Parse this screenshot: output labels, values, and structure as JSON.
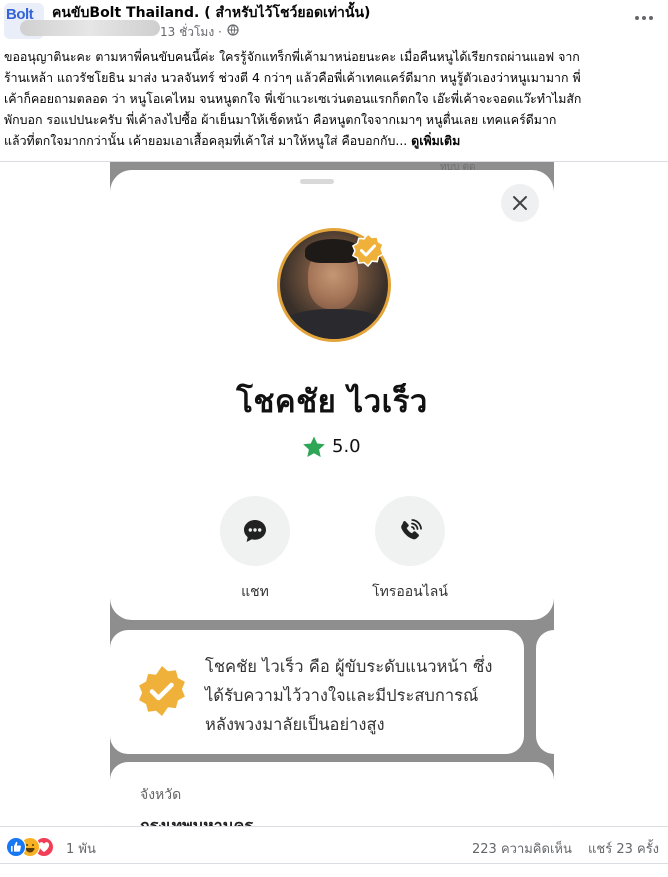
{
  "group": {
    "avatar_text": "Bolt",
    "name": "คนขับBolt Thailand. ( สำหรับไว้โชว์ยอดเท่านั้น)",
    "time": "13 ชั่วโมง ·"
  },
  "post": {
    "lines": [
      "ขออนุญาตินะคะ ตามหาพี่คนขับคนนี้ค่ะ ใครรู้จักแทร็กพี่เค้ามาหน่อยนะคะ เมื่อคืนหนูได้เรียกรถผ่านแอฟ จาก",
      "ร้านเหล้า แถวรัชโยธิน มาส่ง นวลจันทร์ ช่วงตี 4 กว่าๆ แล้วคือพี่เค้าเทคแคร์ดีมาก หนูรู้ตัวเองว่าหนูเมามาก พี่",
      "เค้าก็คอยถามตลอด ว่า หนูโอเคไหม จนหนูตกใจ พี่เข้าแวะเซเว่นตอนแรกก็ตกใจ เอ๊ะพี่เค้าจะจอดแว๊ะทำไมสัก",
      "พักบอก รอแปปนะครับ พี่เค้าลงไปซื้อ ผ้าเย็นมาให้เช็ดหน้า คือหนูตกใจจากเมาๆ หนูตื่นเลย เทคแคร์ดีมาก",
      "แล้วที่ตกใจมากกว่านั้น เค้ายอมเอาเสื้อคลุมที่เค้าใส่ มาให้หนูใส่ คือบอกกับ..."
    ],
    "see_more": "ดูเพิ่มเติม"
  },
  "screenshot": {
    "peek_text": "ทบบ ตด",
    "driver_name": "โชคชัย ไวเร็ว",
    "rating": "5.0",
    "actions": {
      "chat": "แชท",
      "call": "โทรออนไลน์"
    },
    "trust_text": "โชคชัย ไวเร็ว คือ ผู้ขับระดับแนวหน้า ซึ่งได้รับความไว้วางใจและมีประสบการณ์หลังพวงมาลัยเป็นอย่างสูง",
    "province_label": "จังหวัด",
    "province_value": "กรุงเทพมหานคร",
    "colors": {
      "accent_gold": "#f0b13a",
      "star_green": "#2fa556"
    }
  },
  "footer": {
    "reaction_count": "1 พัน",
    "comments": "223 ความคิดเห็น",
    "shares": "แชร์ 23 ครั้ง"
  },
  "icons": {
    "globe": "globe-icon",
    "more": "more-dots-icon",
    "close": "close-icon",
    "chat": "chat-bubble-icon",
    "call": "phone-wifi-icon",
    "verified": "verified-badge-icon",
    "star": "star-icon"
  }
}
